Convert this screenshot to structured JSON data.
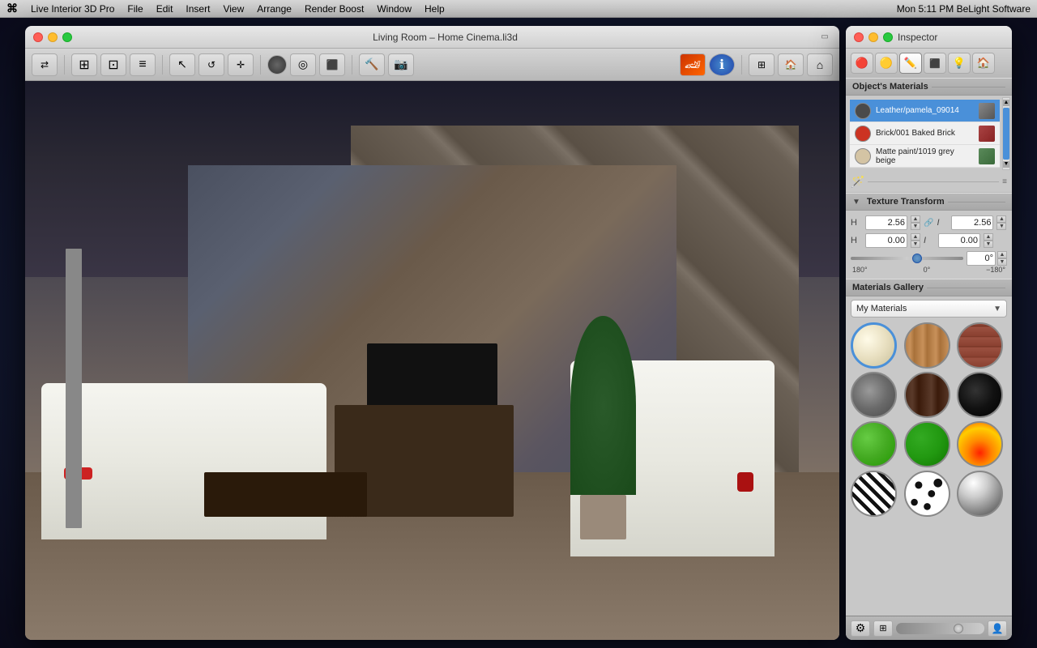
{
  "menubar": {
    "apple": "⌘",
    "items": [
      "Live Interior 3D Pro",
      "File",
      "Edit",
      "Insert",
      "View",
      "Arrange",
      "Render Boost",
      "Window",
      "Help"
    ],
    "right": "Mon 5:11 PM    BeLight Software"
  },
  "window": {
    "title": "Living Room – Home Cinema.li3d",
    "traffic_lights": [
      "red",
      "yellow",
      "green"
    ]
  },
  "toolbar": {
    "buttons": [
      "←→",
      "🏠",
      "📋",
      "≡",
      "↖",
      "↺",
      "✛",
      "⬤",
      "◎",
      "⬛",
      "🔨",
      "📷",
      "🏎",
      "ℹ",
      "⬜",
      "🏠",
      "⌂"
    ]
  },
  "inspector": {
    "title": "Inspector",
    "tabs": [
      "🔴",
      "🟡",
      "✏️",
      "⬛",
      "💡",
      "🏠"
    ],
    "objects_materials_title": "Object's Materials",
    "materials": [
      {
        "name": "Leather/pamela_09014",
        "color": "#4a4a4a",
        "selected": true
      },
      {
        "name": "Brick/001 Baked Brick",
        "color": "#cc3322",
        "selected": false
      },
      {
        "name": "Matte paint/1019 grey beige",
        "color": "#d4c4a4",
        "selected": false
      }
    ],
    "texture_transform": {
      "title": "Texture Transform",
      "scale_x": "2.56",
      "scale_y": "2.56",
      "offset_x": "0.00",
      "offset_y": "0.00",
      "angle": "0°",
      "angle_min": "180°",
      "angle_zero": "0°",
      "angle_max": "−180°"
    },
    "gallery": {
      "title": "Materials Gallery",
      "dropdown_label": "My Materials",
      "items": [
        {
          "id": "cream",
          "class": "mat-cream",
          "selected": true
        },
        {
          "id": "wood-light",
          "class": "mat-wood-light",
          "selected": false
        },
        {
          "id": "brick",
          "class": "mat-brick",
          "selected": false
        },
        {
          "id": "concrete",
          "class": "mat-concrete",
          "selected": false
        },
        {
          "id": "dark-wood",
          "class": "mat-dark-wood",
          "selected": false
        },
        {
          "id": "black",
          "class": "mat-black",
          "selected": false
        },
        {
          "id": "green",
          "class": "mat-green",
          "selected": false
        },
        {
          "id": "dark-green",
          "class": "mat-dark-green",
          "selected": false
        },
        {
          "id": "fire",
          "class": "mat-fire",
          "selected": false
        },
        {
          "id": "zebra",
          "class": "mat-zebra",
          "selected": false
        },
        {
          "id": "spots",
          "class": "mat-spots",
          "selected": false
        },
        {
          "id": "metal",
          "class": "mat-metal",
          "selected": false
        }
      ]
    }
  }
}
